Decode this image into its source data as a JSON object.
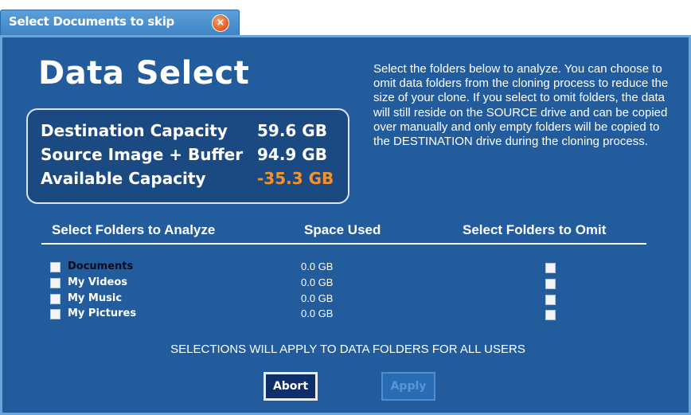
{
  "window": {
    "title": "Select Documents to skip",
    "close_glyph": "×"
  },
  "app_title": "Data Select",
  "capacity": {
    "destination_label": "Destination Capacity",
    "destination_value": "59.6 GB",
    "source_label": "Source Image + Buffer",
    "source_value": "94.9 GB",
    "available_label": "Available Capacity",
    "available_value": "-35.3 GB"
  },
  "description": "Select the folders below to analyze. You can choose to omit data folders from the cloning process to reduce the size of your clone.  If you select to omit folders, the data will still reside on the SOURCE drive and can be copied over manually and only empty folders will be copied to the DESTINATION drive during the cloning process.",
  "columns": {
    "analyze": "Select Folders to Analyze",
    "space": "Space Used",
    "omit": "Select Folders to Omit"
  },
  "folders": [
    {
      "name": "Documents",
      "space": "0.0 GB"
    },
    {
      "name": "My Videos",
      "space": "0.0 GB"
    },
    {
      "name": "My Music",
      "space": "0.0 GB"
    },
    {
      "name": "My Pictures",
      "space": "0.0 GB"
    }
  ],
  "notice": "SELECTIONS WILL APPLY TO DATA FOLDERS FOR ALL USERS",
  "buttons": {
    "abort": "Abort",
    "apply": "Apply"
  },
  "colors": {
    "dialog_bg": "#235c9c",
    "warning": "#f5922a",
    "title_bar": "#4a8fcf"
  }
}
